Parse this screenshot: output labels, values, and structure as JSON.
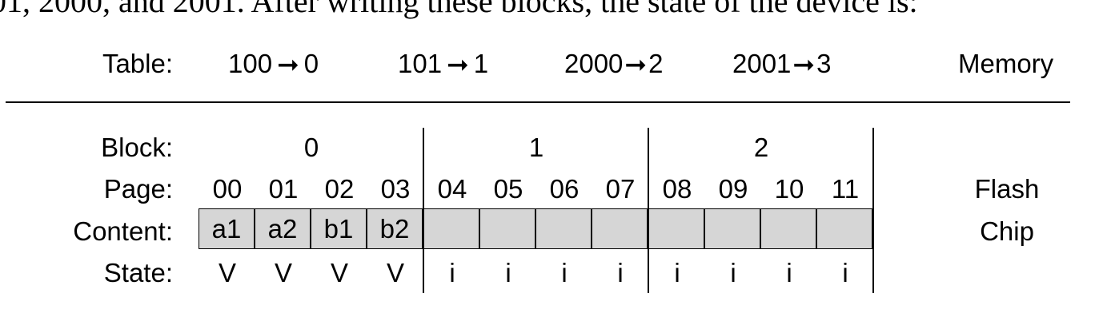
{
  "caption_fragment": "01, 2000, and 2001. After writing these blocks, the state of the device is:",
  "labels": {
    "table": "Table:",
    "block": "Block:",
    "page": "Page:",
    "content": "Content:",
    "state": "State:",
    "memory": "Memory",
    "flash_line1": "Flash",
    "flash_line2": "Chip"
  },
  "mapping": [
    {
      "from": "100",
      "to": "0"
    },
    {
      "from": "101",
      "to": "1"
    },
    {
      "from": "2000",
      "to": "2"
    },
    {
      "from": "2001",
      "to": "3"
    }
  ],
  "blocks": [
    "0",
    "1",
    "2"
  ],
  "pages": [
    "00",
    "01",
    "02",
    "03",
    "04",
    "05",
    "06",
    "07",
    "08",
    "09",
    "10",
    "11"
  ],
  "contents": [
    "a1",
    "a2",
    "b1",
    "b2",
    "",
    "",
    "",
    "",
    "",
    "",
    "",
    ""
  ],
  "states": [
    "V",
    "V",
    "V",
    "V",
    "i",
    "i",
    "i",
    "i",
    "i",
    "i",
    "i",
    "i"
  ],
  "arrow_glyph": "➞"
}
